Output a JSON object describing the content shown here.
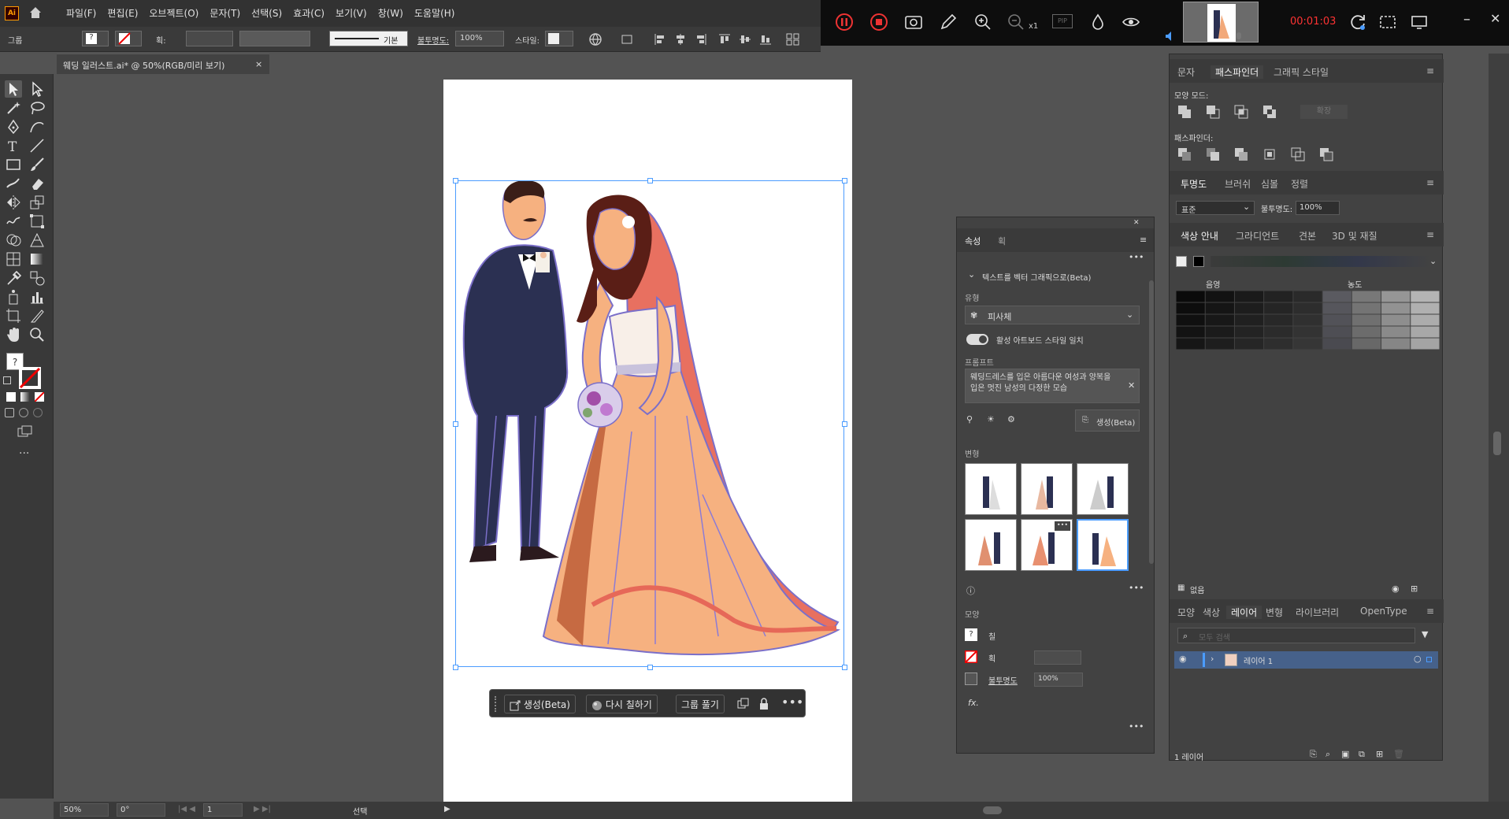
{
  "app": {
    "logo": "Ai"
  },
  "menu": [
    "파일(F)",
    "편집(E)",
    "오브젝트(O)",
    "문자(T)",
    "선택(S)",
    "효과(C)",
    "보기(V)",
    "창(W)",
    "도움말(H)"
  ],
  "recorder": {
    "time": "00:01:03",
    "zoom_label": "x1",
    "pip": "PIP"
  },
  "control_bar": {
    "group_label": "그룹",
    "stroke_label": "획:",
    "stroke_style": "기본",
    "opacity_label": "불투명도:",
    "opacity": "100%",
    "style_label": "스타일:"
  },
  "document_tab": {
    "title": "웨딩 일러스트.ai* @ 50%(RGB/미리 보기)",
    "close": "×"
  },
  "context_bar": {
    "generate": "생성(Beta)",
    "recolor": "다시 칠하기",
    "ungroup": "그룹 풀기"
  },
  "status_bar": {
    "zoom": "50%",
    "rotation": "0°",
    "artboard": "1",
    "tool": "선택"
  },
  "properties": {
    "tab_props": "속성",
    "tab_stroke": "획",
    "section_title": "텍스트를 벡터 그래픽으로(Beta)",
    "type_label": "유형",
    "type_value": "피사체",
    "match_label": "활성 아트보드 스타일 일치",
    "prompt_label": "프롬프트",
    "prompt_text": "웨딩드레스를 입은 아름다운 여성과 양복을 입은 멋진 남성의 다정한 모습",
    "generate_btn": "생성(Beta)",
    "variants_label": "변형",
    "appearance_label": "모양",
    "fill_label": "칠",
    "stroke_label": "획",
    "opacity_label": "불투명도",
    "opacity_value": "100%",
    "fx": "fx."
  },
  "right_dock": {
    "tabs1": [
      "문자",
      "패스파인더",
      "그래픽 스타일"
    ],
    "shape_modes": "모양 모드:",
    "expand": "확장",
    "pathfinder": "패스파인더:",
    "tabs2": [
      "투명도",
      "브러쉬",
      "심볼",
      "정렬"
    ],
    "blend_mode": "표준",
    "opacity_label": "불투명도:",
    "opacity": "100%",
    "tabs3": [
      "색상 안내",
      "그라디언트",
      "견본",
      "3D 및 재질"
    ],
    "tint_label": "음영",
    "shade_label": "농도",
    "none_label": "없음",
    "tabs4": [
      "모양",
      "색상",
      "레이어",
      "변형",
      "라이브러리",
      "OpenType"
    ],
    "search_placeholder": "모두 검색",
    "layer_name": "레이어 1",
    "layer_count": "1 레이어"
  },
  "colors": {
    "accent": "#4b9cff",
    "layer_sel": "#46618a",
    "rec_time": "#ff3333"
  }
}
